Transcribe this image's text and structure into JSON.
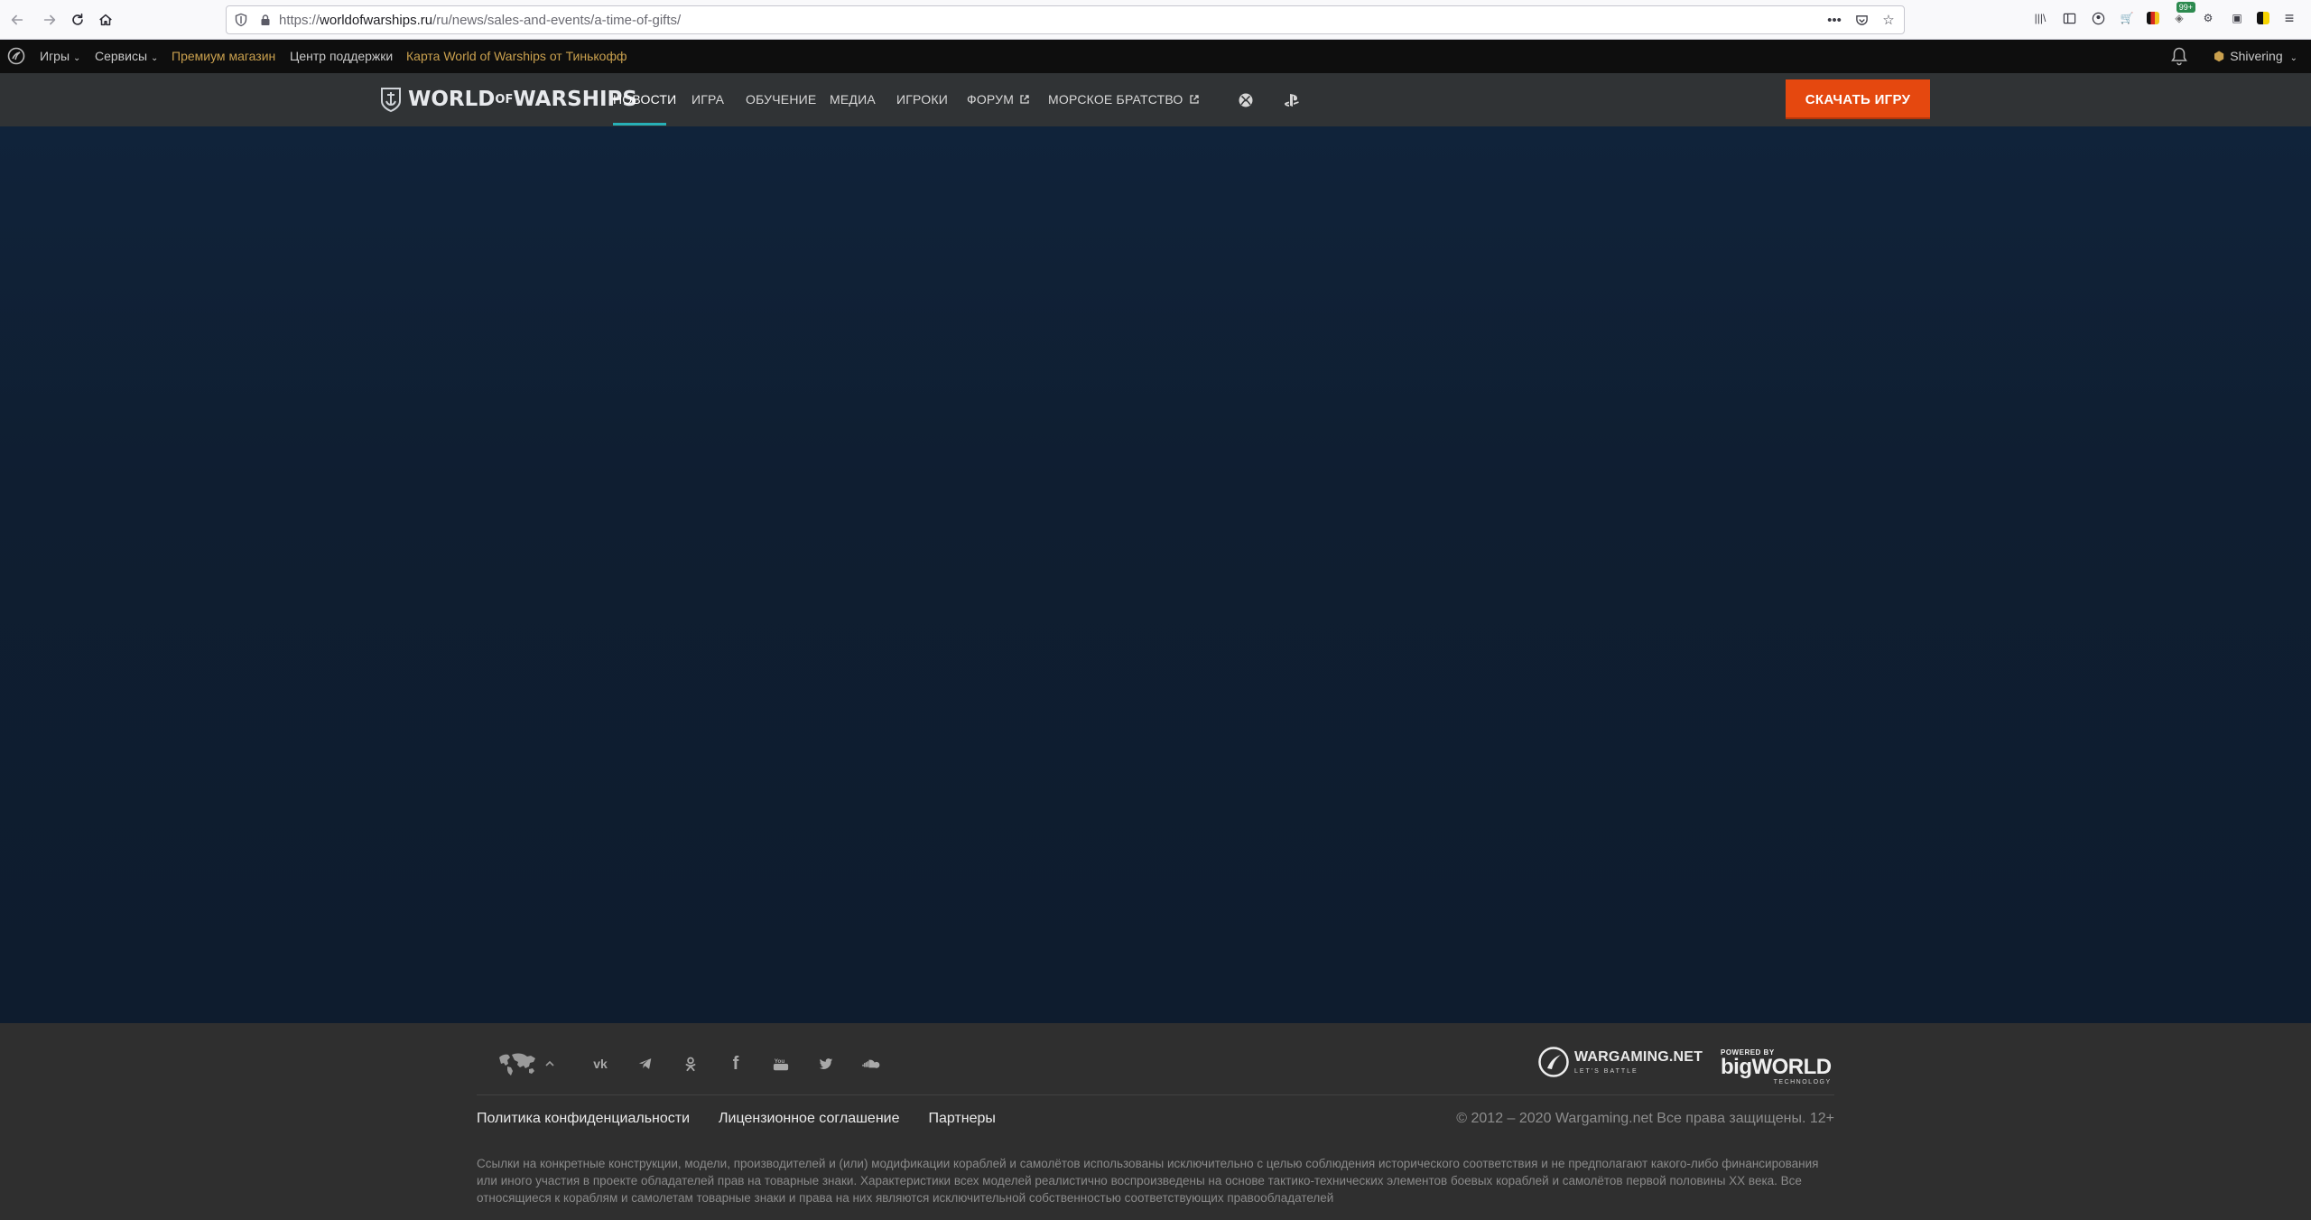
{
  "browser": {
    "url_prefix": "https://",
    "url_host": "worldofwarships.ru",
    "url_path": "/ru/news/sales-and-events/a-time-of-gifts/",
    "ext_badge": "99+"
  },
  "portal": {
    "items": [
      {
        "label": "Игры",
        "has_dropdown": true
      },
      {
        "label": "Сервисы",
        "has_dropdown": true
      },
      {
        "label": "Премиум магазин",
        "highlight": true
      },
      {
        "label": "Центр поддержки"
      },
      {
        "label": "Карта World of Warships от Тинькофф",
        "highlight": true
      }
    ],
    "username": "Shivering"
  },
  "site_nav": {
    "logo_word_1": "WORLD",
    "logo_word_2": "OF",
    "logo_word_3": "WARSHIPS",
    "links": [
      {
        "label": "Новости",
        "active": true
      },
      {
        "label": "Игра"
      },
      {
        "label": "Обучение"
      },
      {
        "label": "Медиа"
      },
      {
        "label": "Игроки"
      },
      {
        "label": "Форум",
        "external": true
      },
      {
        "label": "Морское братство",
        "external": true
      }
    ],
    "platforms": [
      "xbox-icon",
      "playstation-icon"
    ],
    "download_label": "СКАЧАТЬ ИГРУ"
  },
  "footer": {
    "social": [
      "vk-icon",
      "telegram-icon",
      "odnoklassniki-icon",
      "facebook-icon",
      "youtube-icon",
      "twitter-icon",
      "soundcloud-icon"
    ],
    "brand_wg": "WARGAMING.NET",
    "brand_wg_tag": "LET'S BATTLE",
    "brand_bw_powered": "POWERED BY",
    "brand_bw_name": "bigWORLD",
    "brand_bw_tech": "TECHNOLOGY",
    "links": [
      "Политика конфиденциальности",
      "Лицензионное соглашение",
      "Партнеры"
    ],
    "copyright": "© 2012 – 2020 Wargaming.net Все права защищены. 12+",
    "disclaimer": "Ссылки на конкретные конструкции, модели, производителей и (или) модификации кораблей и самолётов использованы исключительно с целью соблюдения исторического соответствия и не предполагают какого-либо финансирования или иного участия в проекте обладателей прав на товарные знаки. Характеристики всех моделей реалистично воспроизведены на основе тактико-технических элементов боевых кораблей и самолётов первой половины XX века. Все относящиеся к кораблям и самолетам товарные знаки и права на них являются исключительной собственностью соответствующих правообладателей"
  }
}
